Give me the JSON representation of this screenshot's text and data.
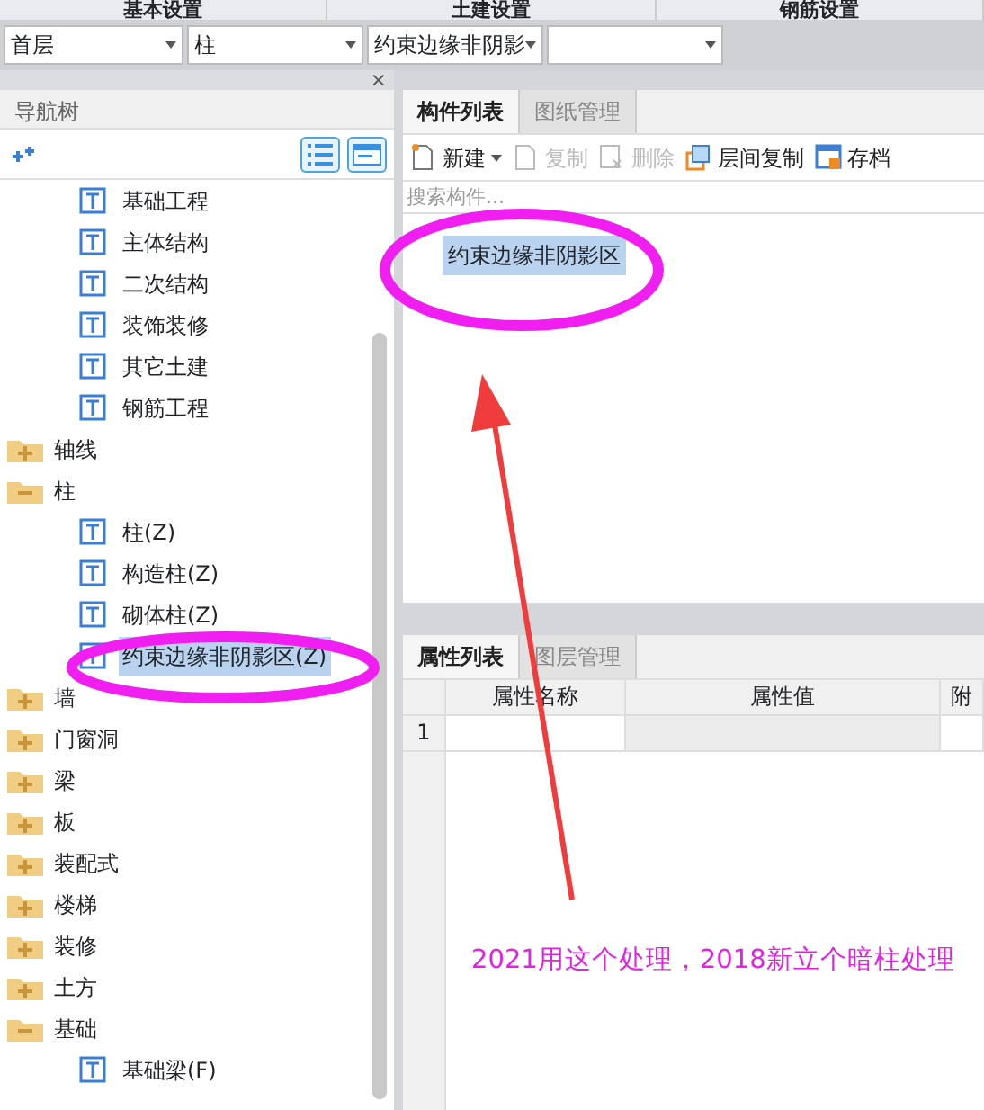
{
  "top_tabs": [
    "基本设置",
    "土建设置",
    "钢筋设置"
  ],
  "selectors": [
    {
      "kind": "dropdown",
      "value": "首层"
    },
    {
      "kind": "dropdown",
      "value": "柱"
    },
    {
      "kind": "dropdown",
      "value": "约束边缘非阴影"
    },
    {
      "kind": "dropdown"
    }
  ],
  "nav_panel": {
    "title": "导航树",
    "close": "×"
  },
  "tree": [
    {
      "kind": "item",
      "label": "基础工程",
      "selected": false
    },
    {
      "kind": "item",
      "label": "主体结构",
      "selected": false
    },
    {
      "kind": "item",
      "label": "二次结构",
      "selected": false
    },
    {
      "kind": "item",
      "label": "装饰装修",
      "selected": false
    },
    {
      "kind": "item",
      "label": "其它土建",
      "selected": false
    },
    {
      "kind": "item",
      "label": "钢筋工程",
      "selected": false
    },
    {
      "kind": "folder",
      "label": "轴线",
      "expanded": false
    },
    {
      "kind": "folder",
      "label": "柱",
      "expanded": true,
      "children": [
        {
          "kind": "item",
          "label": "柱(Z)",
          "selected": false
        },
        {
          "kind": "item",
          "label": "构造柱(Z)",
          "selected": false
        },
        {
          "kind": "item",
          "label": "砌体柱(Z)",
          "selected": false
        },
        {
          "kind": "item",
          "label": "约束边缘非阴影区(Z)",
          "selected": true
        }
      ]
    },
    {
      "kind": "folder",
      "label": "墙",
      "expanded": false
    },
    {
      "kind": "folder",
      "label": "门窗洞",
      "expanded": false
    },
    {
      "kind": "folder",
      "label": "梁",
      "expanded": false
    },
    {
      "kind": "folder",
      "label": "板",
      "expanded": false
    },
    {
      "kind": "folder",
      "label": "装配式",
      "expanded": false
    },
    {
      "kind": "folder",
      "label": "楼梯",
      "expanded": false
    },
    {
      "kind": "folder",
      "label": "装修",
      "expanded": false
    },
    {
      "kind": "folder",
      "label": "土方",
      "expanded": false
    },
    {
      "kind": "folder",
      "label": "基础",
      "expanded": true,
      "children": [
        {
          "kind": "item",
          "label": "基础梁(F)",
          "selected": false
        }
      ]
    }
  ],
  "component_tabs": [
    {
      "label": "构件列表",
      "selected": true
    },
    {
      "label": "图纸管理",
      "selected": false
    }
  ],
  "toolbar": [
    {
      "label": "新建",
      "disabled": false,
      "dropdown": true
    },
    {
      "label": "复制",
      "disabled": true
    },
    {
      "label": "删除",
      "disabled": true
    },
    {
      "label": "层间复制",
      "disabled": false
    },
    {
      "label": "存档",
      "disabled": false
    }
  ],
  "search": {
    "placeholder": "搜索构件..."
  },
  "components": [
    {
      "label": "约束边缘非阴影区",
      "selected": true
    }
  ],
  "property_tabs": [
    {
      "label": "属性列表",
      "selected": true
    },
    {
      "label": "图层管理",
      "selected": false
    }
  ],
  "property_table": {
    "columns": [
      "属性名称",
      "属性值",
      "附"
    ],
    "rows": [
      {
        "number": "1"
      }
    ]
  },
  "annotation": {
    "note": "2021用这个处理，2018新立个暗柱处理"
  }
}
